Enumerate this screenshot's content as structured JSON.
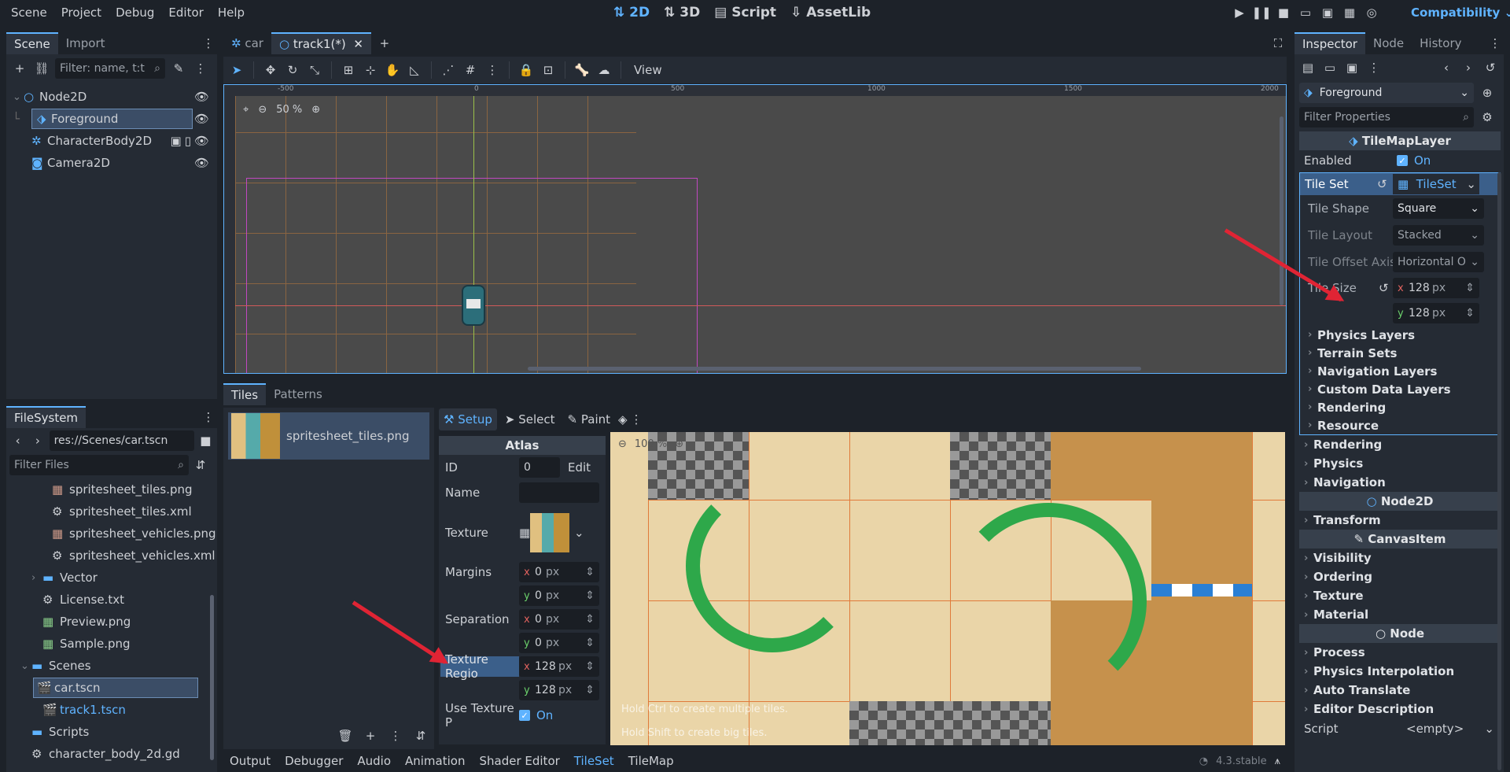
{
  "menu": [
    "Scene",
    "Project",
    "Debug",
    "Editor",
    "Help"
  ],
  "workspaces": {
    "w2d": "2D",
    "w3d": "3D",
    "script": "Script",
    "assetlib": "AssetLib"
  },
  "renderer": "Compatibility",
  "scene_dock": {
    "tabs": [
      "Scene",
      "Import"
    ],
    "filter_placeholder": "Filter: name, t:t",
    "nodes": [
      "Node2D",
      "Foreground",
      "CharacterBody2D",
      "Camera2D"
    ]
  },
  "filesystem": {
    "tab": "FileSystem",
    "path": "res://Scenes/car.tscn",
    "filter_placeholder": "Filter Files",
    "items": [
      "spritesheet_tiles.png",
      "spritesheet_tiles.xml",
      "spritesheet_vehicles.png",
      "spritesheet_vehicles.xml",
      "Vector",
      "License.txt",
      "Preview.png",
      "Sample.png",
      "Scenes",
      "car.tscn",
      "track1.tscn",
      "Scripts",
      "character_body_2d.gd"
    ]
  },
  "editor_tabs": [
    "car",
    "track1(*)"
  ],
  "toolbar": {
    "view": "View",
    "zoom": "50 %"
  },
  "ruler": [
    "-500",
    "0",
    "500",
    "1000",
    "1500",
    "2000"
  ],
  "bottom_panel": {
    "tabs": [
      "Tiles",
      "Patterns"
    ],
    "source": "spritesheet_tiles.png",
    "modes": {
      "setup": "Setup",
      "select": "Select",
      "paint": "Paint"
    },
    "atlas": {
      "title": "Atlas",
      "id_label": "ID",
      "id_value": "0",
      "edit": "Edit",
      "name_label": "Name",
      "texture_label": "Texture",
      "margins_label": "Margins",
      "margins_x": "0",
      "margins_y": "0",
      "separation_label": "Separation",
      "separation_x": "0",
      "separation_y": "0",
      "region_label": "Texture Regio",
      "region_x": "128",
      "region_y": "128",
      "use_texture_label": "Use Texture P",
      "use_texture_value": "On",
      "unit": "px"
    },
    "atlas_zoom": "100 %",
    "hints": [
      "Hold Ctrl to create multiple tiles.",
      "Hold Shift to create big tiles."
    ]
  },
  "output_tabs": [
    "Output",
    "Debugger",
    "Audio",
    "Animation",
    "Shader Editor",
    "TileSet",
    "TileMap"
  ],
  "version": "4.3.stable",
  "inspector": {
    "tabs": [
      "Inspector",
      "Node",
      "History"
    ],
    "object": "Foreground",
    "filter_placeholder": "Filter Properties",
    "class_title": "TileMapLayer",
    "enabled_label": "Enabled",
    "enabled_value": "On",
    "tileset_label": "Tile Set",
    "tileset_value": "TileSet",
    "tile_shape_label": "Tile Shape",
    "tile_shape_value": "Square",
    "tile_layout_label": "Tile Layout",
    "tile_layout_value": "Stacked",
    "tile_offset_label": "Tile Offset Axis",
    "tile_offset_value": "Horizontal O",
    "tile_size_label": "Tile Size",
    "tile_size_x": "128",
    "tile_size_y": "128",
    "unit": "px",
    "tileset_groups": [
      "Physics Layers",
      "Terrain Sets",
      "Navigation Layers",
      "Custom Data Layers",
      "Rendering",
      "Resource"
    ],
    "layer_groups": [
      "Rendering",
      "Physics",
      "Navigation"
    ],
    "node2d_title": "Node2D",
    "node2d_groups": [
      "Transform"
    ],
    "canvas_title": "CanvasItem",
    "canvas_groups": [
      "Visibility",
      "Ordering",
      "Texture",
      "Material"
    ],
    "node_title": "Node",
    "node_groups": [
      "Process",
      "Physics Interpolation",
      "Auto Translate",
      "Editor Description"
    ],
    "script_label": "Script",
    "script_value": "<empty>"
  }
}
